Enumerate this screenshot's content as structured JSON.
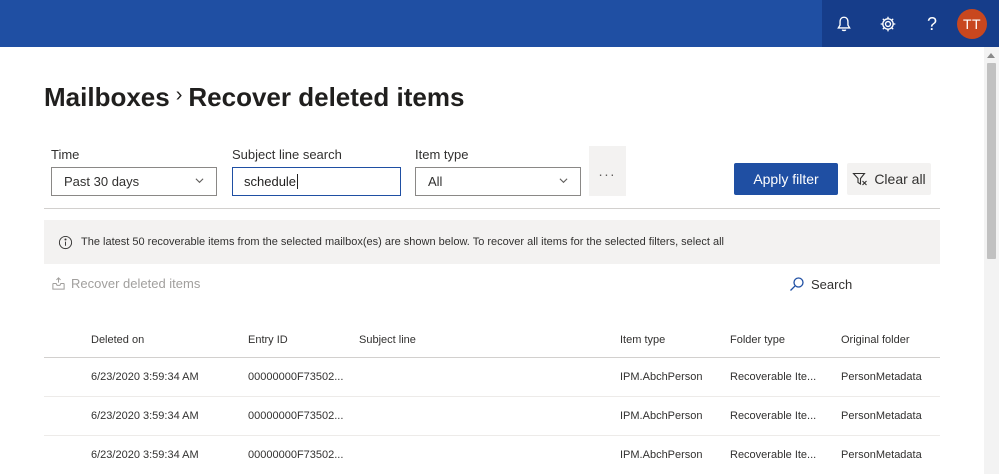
{
  "topbar": {
    "notification_icon": "bell-icon",
    "settings_icon": "gear-icon",
    "help_glyph": "?",
    "avatar_initials": "TT",
    "colors": {
      "bar": "#1f4fa3",
      "right": "#163d8a",
      "avatar": "#c8471f"
    }
  },
  "breadcrumb": {
    "parent": "Mailboxes",
    "separator": "›",
    "current": "Recover deleted items"
  },
  "filters": {
    "time": {
      "label": "Time",
      "value": "Past 30 days"
    },
    "subject": {
      "label": "Subject line search",
      "value": "schedule"
    },
    "item_type": {
      "label": "Item type",
      "value": "All"
    },
    "more_label": "...",
    "apply_label": "Apply filter",
    "clear_label": "Clear all"
  },
  "info": {
    "message": "The latest 50 recoverable items from the selected mailbox(es) are shown below. To recover all items for the selected filters, select all"
  },
  "commands": {
    "recover_label": "Recover deleted items",
    "search_label": "Search"
  },
  "table": {
    "headers": [
      "Deleted on",
      "Entry ID",
      "Subject line",
      "Item type",
      "Folder type",
      "Original folder"
    ],
    "rows": [
      [
        "6/23/2020 3:59:34 AM",
        "00000000F73502...",
        "",
        "IPM.AbchPerson",
        "Recoverable Ite...",
        "PersonMetadata"
      ],
      [
        "6/23/2020 3:59:34 AM",
        "00000000F73502...",
        "",
        "IPM.AbchPerson",
        "Recoverable Ite...",
        "PersonMetadata"
      ],
      [
        "6/23/2020 3:59:34 AM",
        "00000000F73502...",
        "",
        "IPM.AbchPerson",
        "Recoverable Ite...",
        "PersonMetadata"
      ]
    ]
  }
}
